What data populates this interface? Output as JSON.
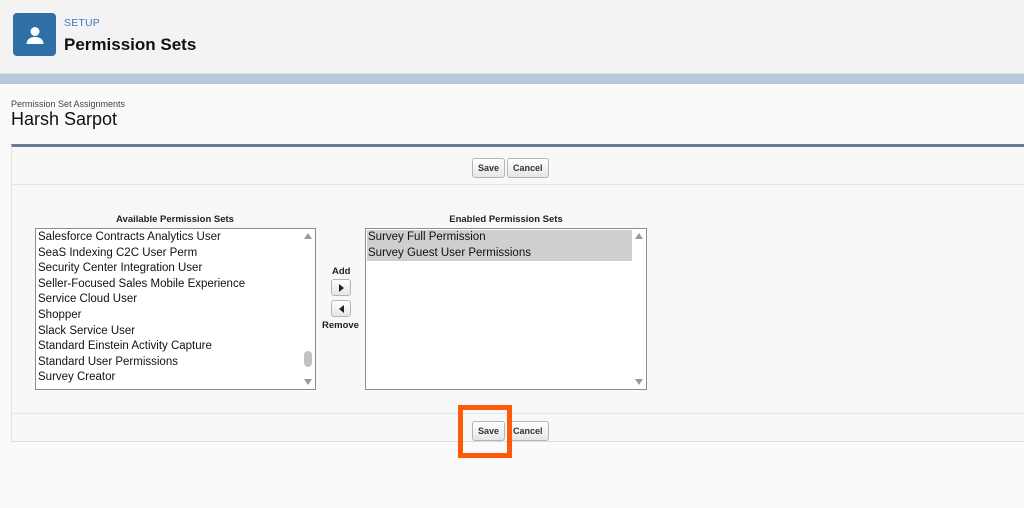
{
  "header": {
    "kicker": "SETUP",
    "title": "Permission Sets",
    "icon": "user-icon"
  },
  "page": {
    "subtitle": "Permission Set Assignments",
    "person": "Harsh Sarpot"
  },
  "toolbar": {
    "save_label": "Save",
    "cancel_label": "Cancel"
  },
  "available": {
    "label": "Available Permission Sets",
    "items": [
      "Salesforce Contracts Analytics User",
      "SeaS Indexing C2C User Perm",
      "Security Center Integration User",
      "Seller-Focused Sales Mobile Experience",
      "Service Cloud User",
      "Shopper",
      "Slack Service User",
      "Standard Einstein Activity Capture",
      "Standard User Permissions",
      "Survey Creator"
    ]
  },
  "enabled": {
    "label": "Enabled Permission Sets",
    "items": [
      "Survey Full Permission",
      "Survey Guest User Permissions"
    ]
  },
  "mover": {
    "add_label": "Add",
    "remove_label": "Remove"
  },
  "colors": {
    "accent": "#2f6fa7",
    "highlight": "#ff5a0a"
  }
}
